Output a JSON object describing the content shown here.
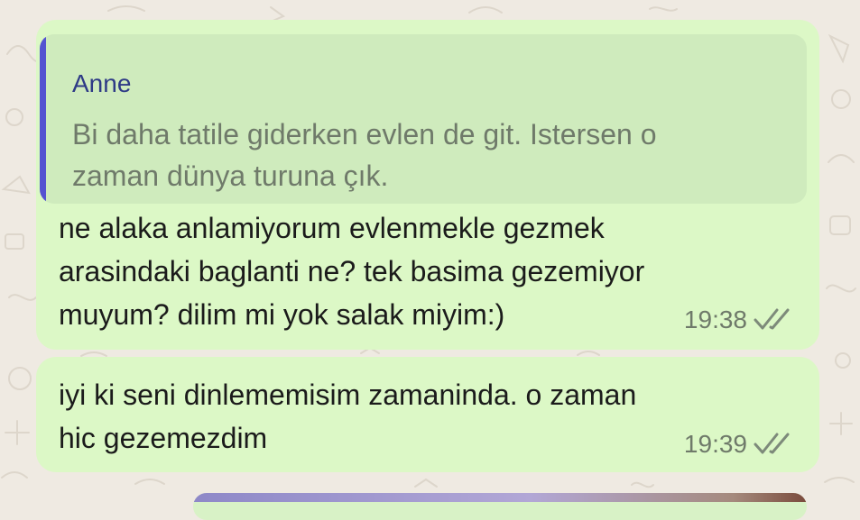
{
  "chat": {
    "messages": [
      {
        "quote": {
          "author": "Anne",
          "text": "Bi daha tatile giderken evlen de git. Istersen o\nzaman dünya turuna çık."
        },
        "text": "ne alaka anlamiyorum evlenmekle gezmek\narasindaki baglanti ne? tek basima gezemiyor\nmuyum? dilim mi yok salak miyim:)",
        "time": "19:38",
        "status_icon": "double-check-icon"
      },
      {
        "text": "iyi ki seni dinlememisim zamaninda. o zaman\nhic gezemezdim",
        "time": "19:39",
        "status_icon": "double-check-icon"
      }
    ]
  },
  "colors": {
    "outgoing_bubble": "#dcf8c6",
    "quote_background": "#cfebbd",
    "quote_bar": "#5452d1",
    "quote_author": "#2e3a86",
    "chat_background": "#efeae2"
  }
}
